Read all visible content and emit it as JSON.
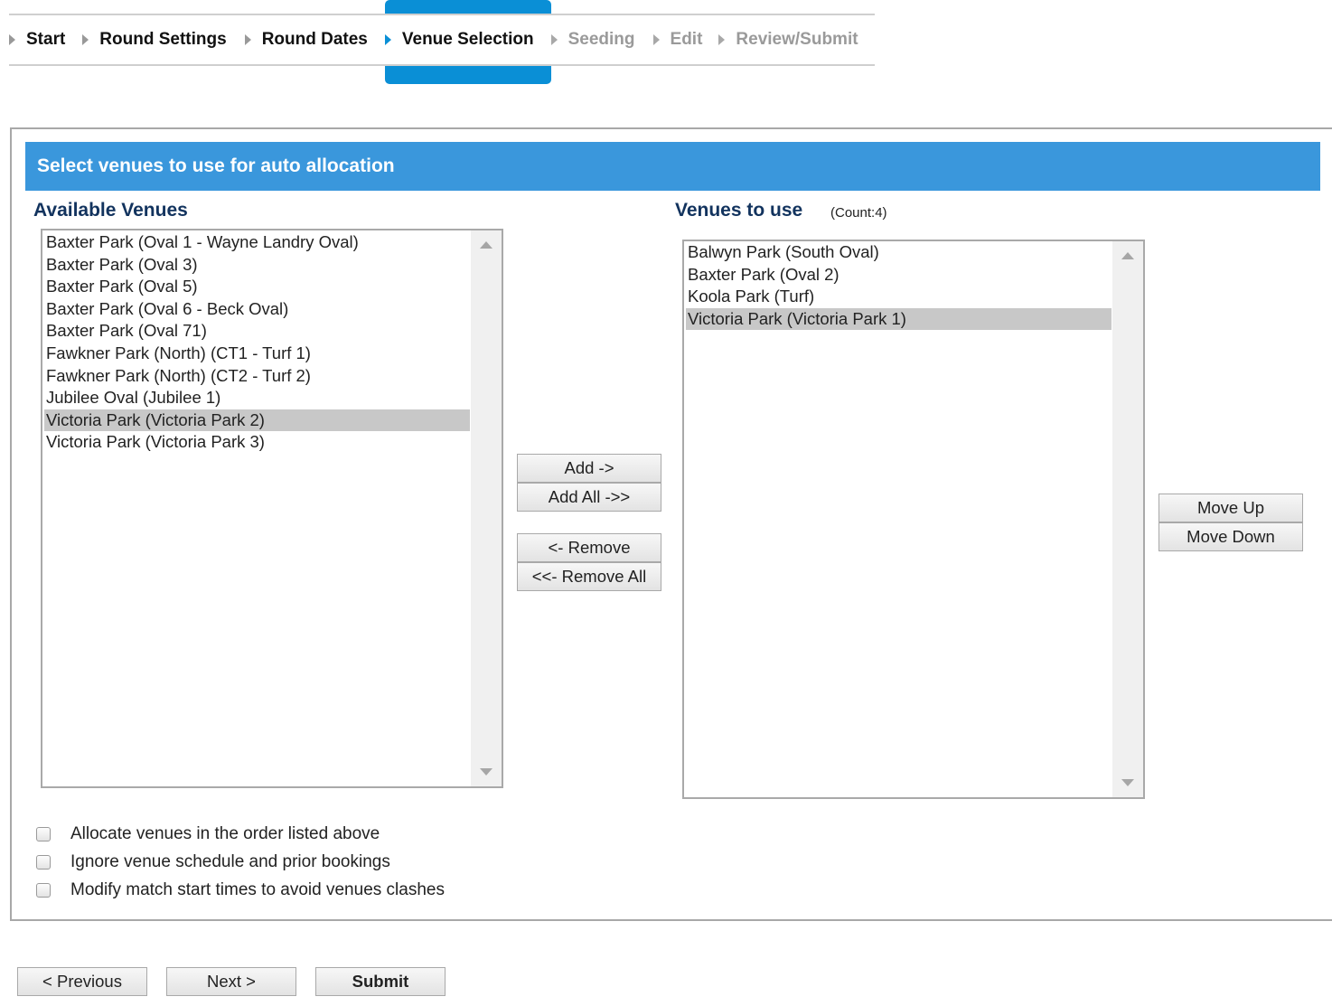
{
  "wizard": {
    "steps": [
      {
        "label": "Start",
        "state": "done"
      },
      {
        "label": "Round Settings",
        "state": "done"
      },
      {
        "label": "Round Dates",
        "state": "done"
      },
      {
        "label": "Venue Selection",
        "state": "current"
      },
      {
        "label": "Seeding",
        "state": "future"
      },
      {
        "label": "Edit",
        "state": "future"
      },
      {
        "label": "Review/Submit",
        "state": "future"
      }
    ],
    "accent_color": "#0a8fd6"
  },
  "panel": {
    "header": "Select venues to use for auto allocation",
    "header_color": "#3a97dc"
  },
  "available": {
    "title": "Available Venues",
    "items": [
      "Baxter Park (Oval 1 - Wayne Landry Oval)",
      "Baxter Park (Oval 3)",
      "Baxter Park (Oval 5)",
      "Baxter Park (Oval 6 - Beck Oval)",
      "Baxter Park (Oval 71)",
      "Fawkner Park (North) (CT1 - Turf 1)",
      "Fawkner Park (North) (CT2 - Turf 2)",
      "Jubilee Oval (Jubilee 1)",
      "Victoria Park (Victoria Park 2)",
      "Victoria Park (Victoria Park 3)"
    ],
    "selected": "Victoria Park (Victoria Park 2)"
  },
  "selected_venues": {
    "title": "Venues to use",
    "count_label": "(Count:4)",
    "items": [
      "Balwyn Park (South Oval)",
      "Baxter Park (Oval 2)",
      "Koola Park (Turf)",
      "Victoria Park (Victoria Park 1)"
    ],
    "selected": "Victoria Park (Victoria Park 1)"
  },
  "buttons": {
    "add": "Add ->",
    "add_all": "Add All ->>",
    "remove": "<- Remove",
    "remove_all": "<<- Remove All",
    "move_up": "Move Up",
    "move_down": "Move Down"
  },
  "options": [
    {
      "label": "Allocate venues in the order listed above",
      "checked": false
    },
    {
      "label": "Ignore venue schedule and prior bookings",
      "checked": false
    },
    {
      "label": "Modify match start times to avoid venues clashes",
      "checked": false
    }
  ],
  "footer": {
    "previous": "< Previous",
    "next": "Next >",
    "submit": "Submit"
  }
}
